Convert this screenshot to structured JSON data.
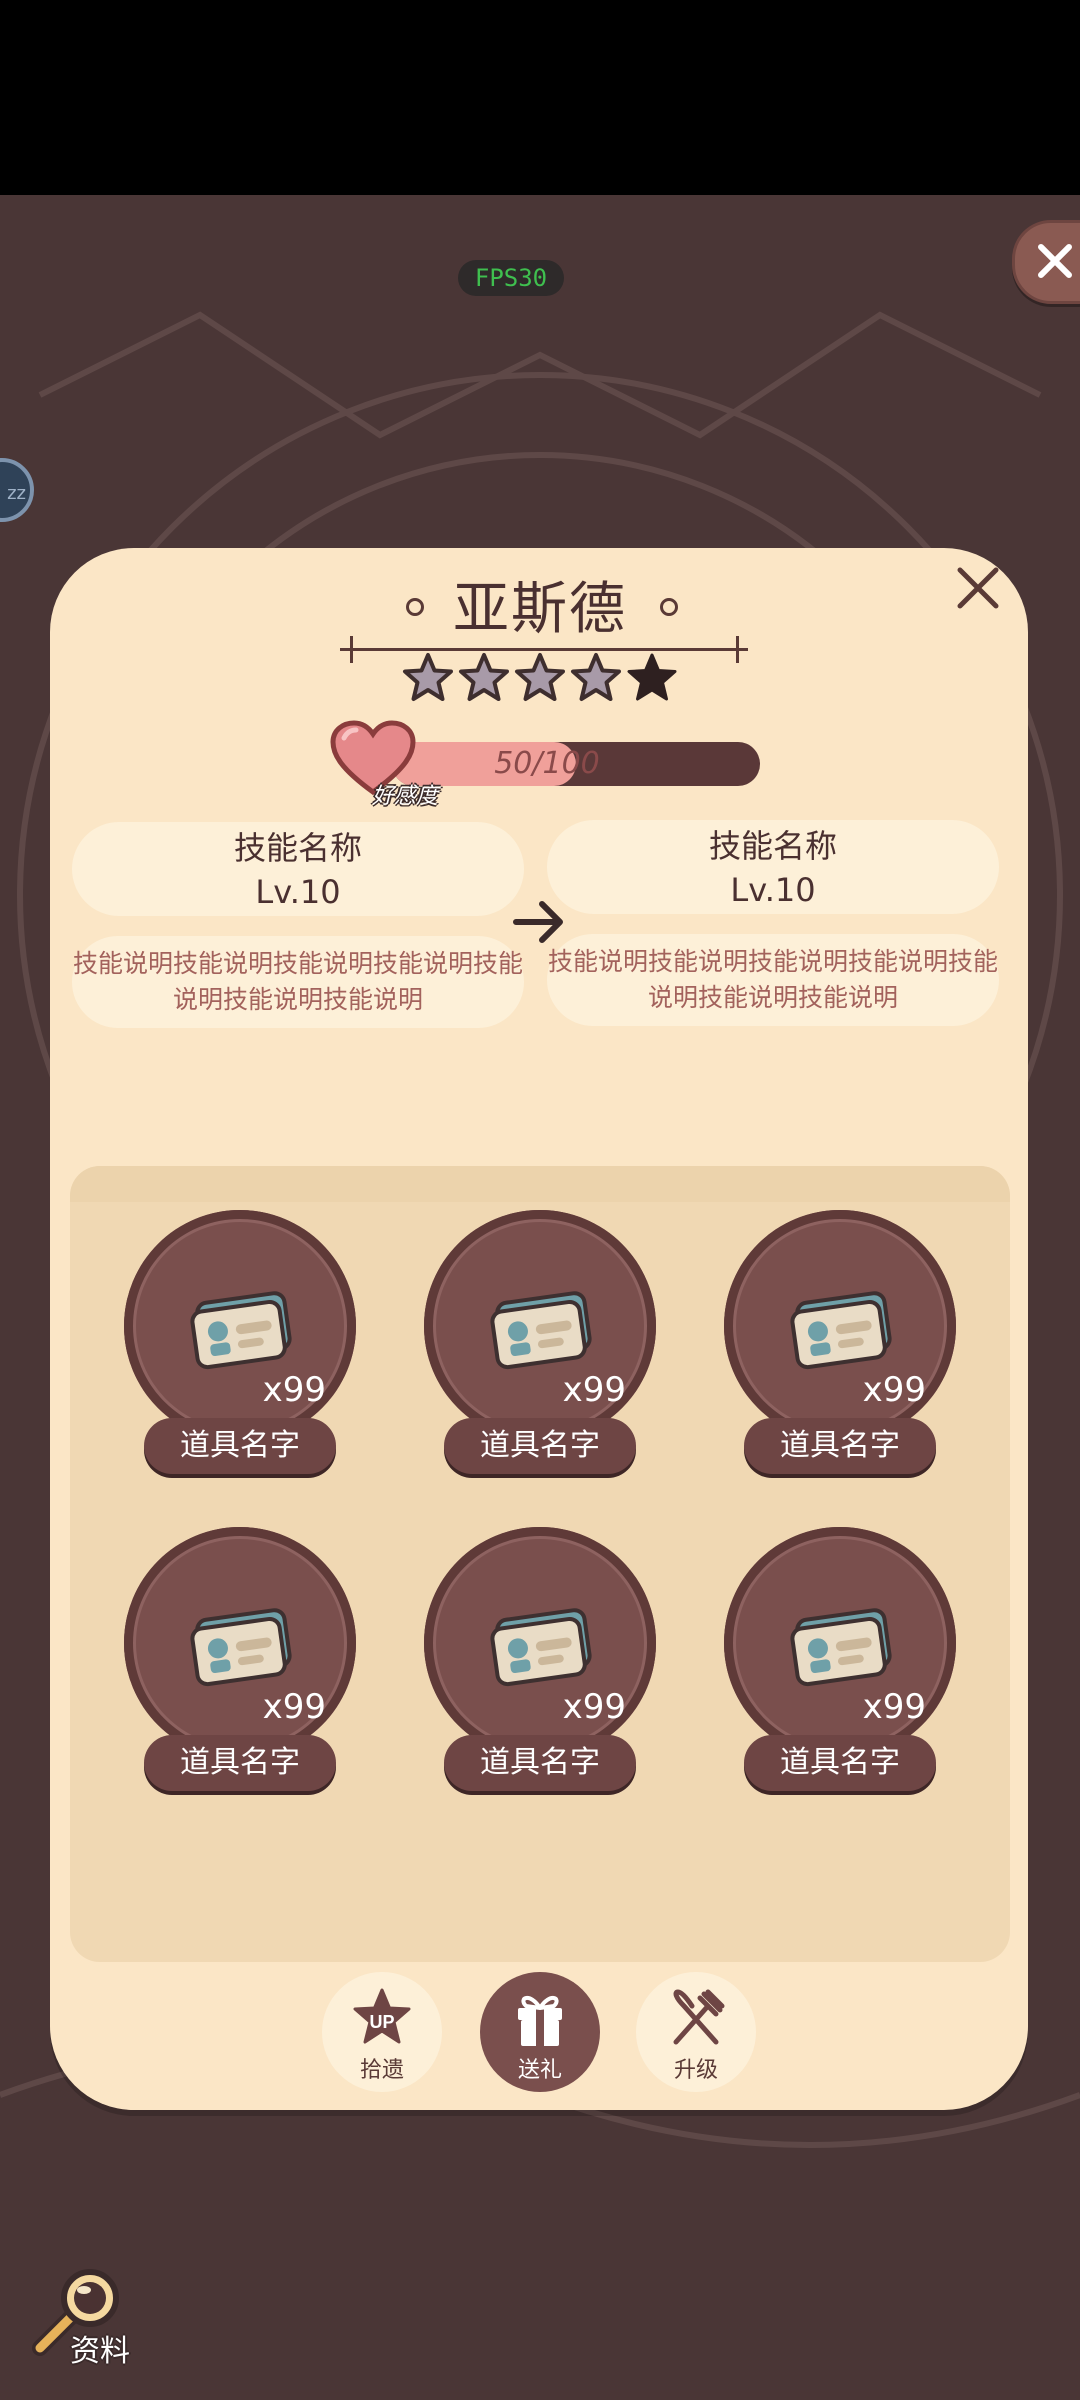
{
  "hud": {
    "fps": "FPS30",
    "side_badge": "zz"
  },
  "character": {
    "name": "亚斯德",
    "stars_total": 5,
    "stars_filled": 1
  },
  "affinity": {
    "current": 50,
    "max": 100,
    "text": "50/100",
    "label": "好感度"
  },
  "skill_current": {
    "name": "技能名称",
    "level": "Lv.10",
    "desc": "技能说明技能说明技能说明技能说明技能说明技能说明技能说明"
  },
  "skill_next": {
    "name": "技能名称",
    "level": "Lv.10",
    "desc": "技能说明技能说明技能说明技能说明技能说明技能说明技能说明"
  },
  "items": [
    {
      "name": "道具名字",
      "count": "x99",
      "icon": "id-card-icon"
    },
    {
      "name": "道具名字",
      "count": "x99",
      "icon": "id-card-icon"
    },
    {
      "name": "道具名字",
      "count": "x99",
      "icon": "id-card-icon"
    },
    {
      "name": "道具名字",
      "count": "x99",
      "icon": "id-card-icon"
    },
    {
      "name": "道具名字",
      "count": "x99",
      "icon": "id-card-icon"
    },
    {
      "name": "道具名字",
      "count": "x99",
      "icon": "id-card-icon"
    }
  ],
  "tabs": [
    {
      "label": "拾遗",
      "badge": "UP",
      "icon": "star-up-icon",
      "active": false
    },
    {
      "label": "送礼",
      "icon": "gift-icon",
      "active": true
    },
    {
      "label": "升级",
      "icon": "fork-knife-icon",
      "active": false
    }
  ],
  "info_button": {
    "label": "资料",
    "icon": "magnifier-icon"
  },
  "colors": {
    "panel": "#fbe6c6",
    "accent": "#7a4f4d",
    "background": "#4a3636",
    "affinity_fill": "#f0a09a"
  }
}
